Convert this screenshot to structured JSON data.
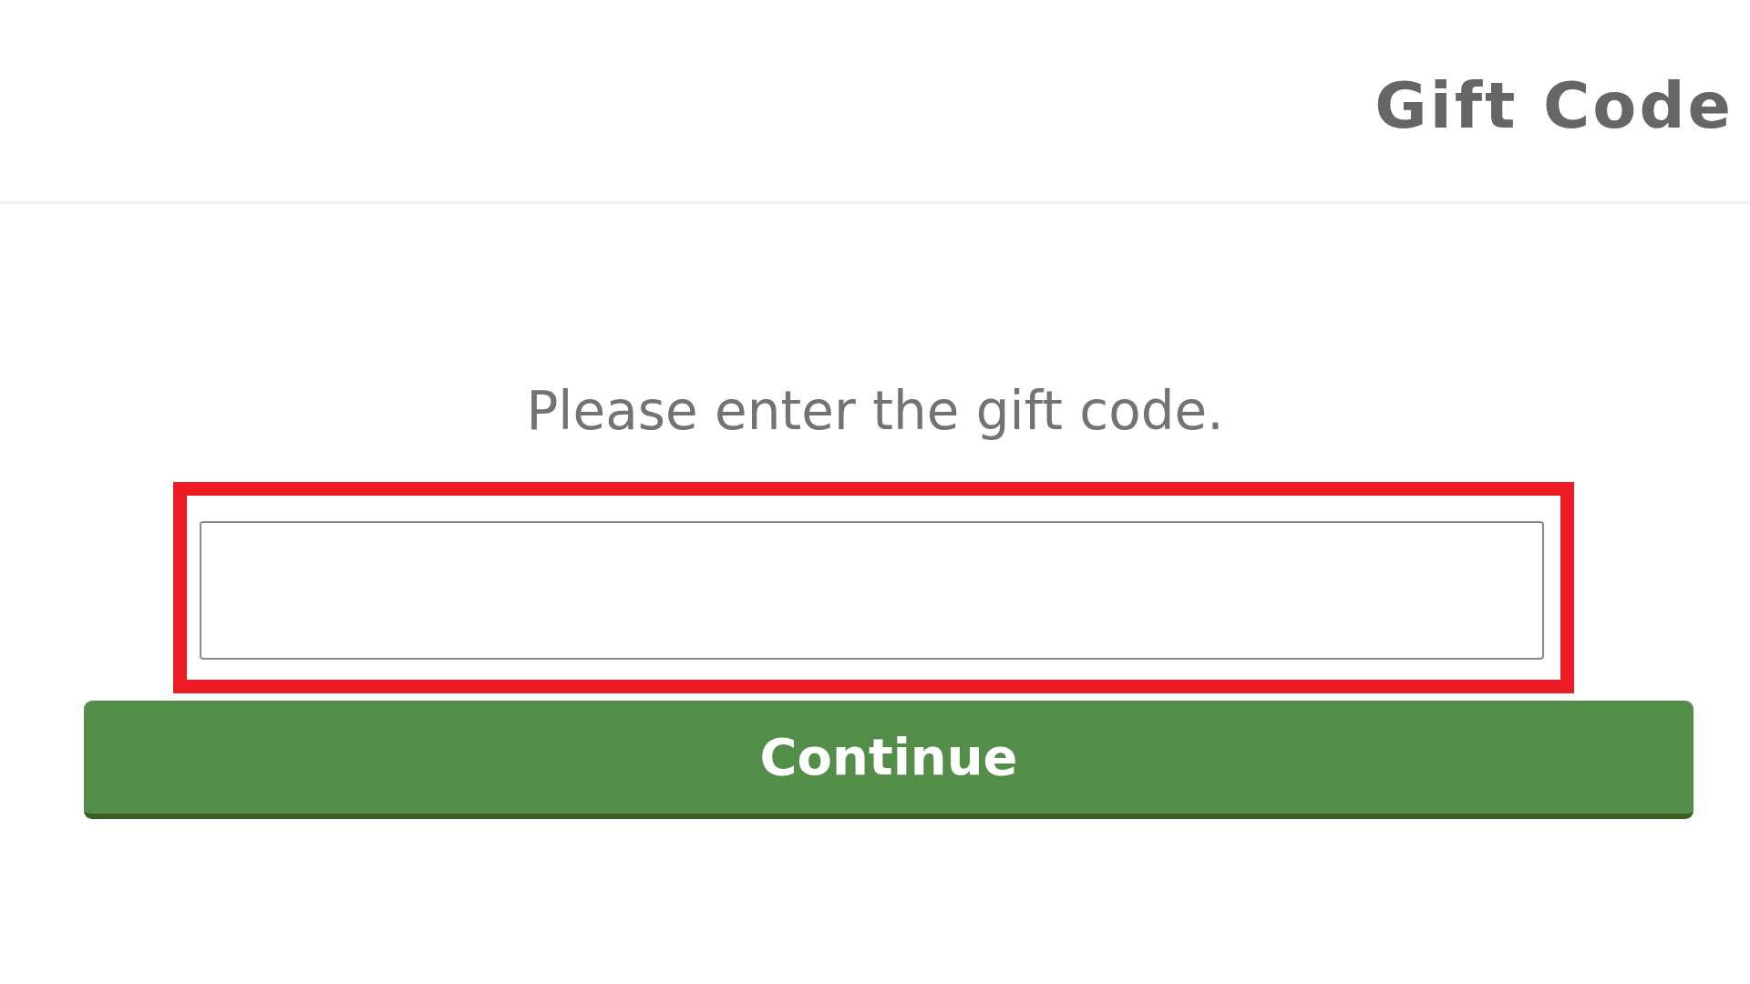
{
  "header": {
    "title": "Gift Code"
  },
  "form": {
    "prompt": "Please enter the gift code.",
    "code_field": {
      "highlighted": true
    },
    "submit_button": {
      "label": "Continue"
    }
  }
}
